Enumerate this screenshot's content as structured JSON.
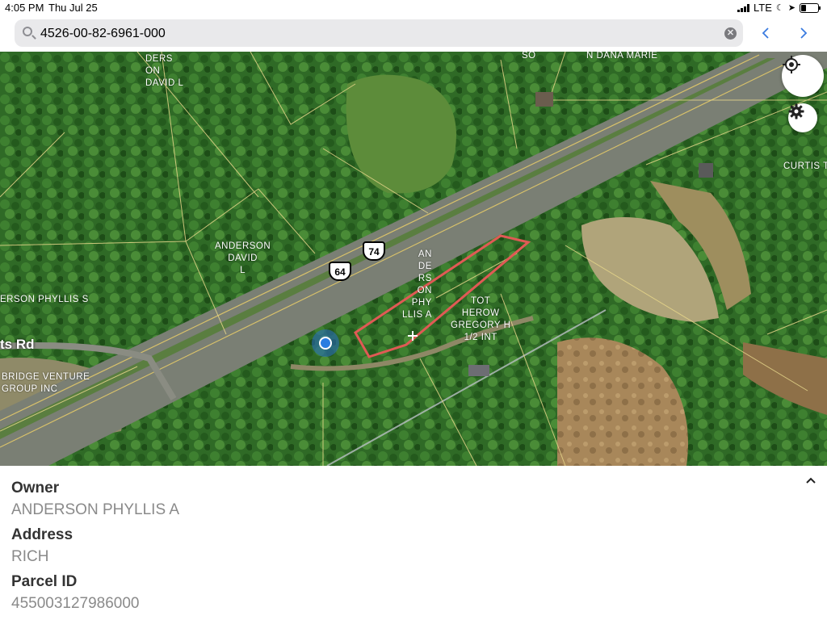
{
  "status_bar": {
    "time": "4:05 PM",
    "date": "Thu Jul 25",
    "network": "LTE"
  },
  "search": {
    "value": "4526-00-82-6961-000"
  },
  "nav": {
    "back_icon": "chevron-left-icon",
    "forward_icon": "chevron-right-icon"
  },
  "map": {
    "parcel_labels": [
      {
        "text": "DERS\nON\nDAVID L"
      },
      {
        "text": "SO"
      },
      {
        "text": "N DANA MARIE"
      },
      {
        "text": "CURTIS T"
      },
      {
        "text": "ANDERSON\nDAVID\nL"
      },
      {
        "text": "ERSON PHYLLIS S"
      },
      {
        "text": "BRIDGE VENTURE\nGROUP INC"
      },
      {
        "text": "AN\nDE\nRS\nON\nPHY\nLLIS A"
      },
      {
        "text": "TOT\nHEROW\nGREGORY H\n1/2 INT"
      }
    ],
    "road_label": "ts Rd",
    "shields": [
      "74",
      "64"
    ],
    "highlight_color": "#e05a55"
  },
  "info": {
    "owner_label": "Owner",
    "owner_value": "ANDERSON PHYLLIS A",
    "address_label": "Address",
    "address_value": "RICH",
    "parcel_label": "Parcel ID",
    "parcel_value": "455003127986000"
  }
}
